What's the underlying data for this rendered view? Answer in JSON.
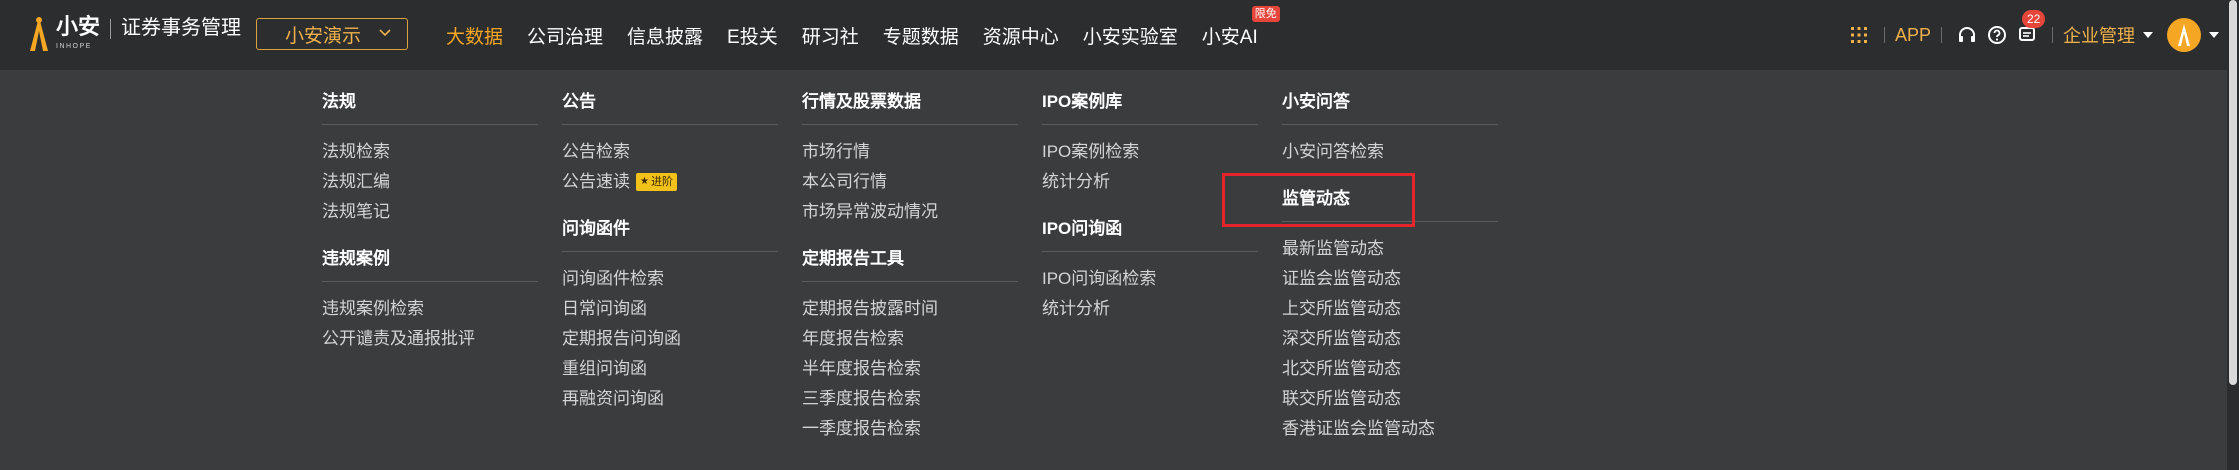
{
  "brand": {
    "name": "小安",
    "sub": "INHOPE",
    "product": "证券事务管理",
    "accent": "#f5a623"
  },
  "company_select": {
    "value": "小安演示"
  },
  "nav": [
    {
      "label": "大数据",
      "active": true
    },
    {
      "label": "公司治理"
    },
    {
      "label": "信息披露"
    },
    {
      "label": "E投关"
    },
    {
      "label": "研习社"
    },
    {
      "label": "专题数据"
    },
    {
      "label": "资源中心"
    },
    {
      "label": "小安实验室"
    },
    {
      "label": "小安AI",
      "badge": "限免"
    }
  ],
  "tools": {
    "grid_icon": "apps-grid-icon",
    "app_label": "APP",
    "headset_icon": "headset-icon",
    "help_icon": "question-icon",
    "message_icon": "message-icon",
    "notification_count": "22",
    "admin_label": "企业管理"
  },
  "menu": {
    "col1": {
      "g1": {
        "title": "法规",
        "items": [
          "法规检索",
          "法规汇编",
          "法规笔记"
        ]
      },
      "g2": {
        "title": "违规案例",
        "items": [
          "违规案例检索",
          "公开谴责及通报批评"
        ]
      }
    },
    "col2": {
      "g1": {
        "title": "公告",
        "items": [
          "公告检索",
          "公告速读"
        ],
        "tag": "进阶"
      },
      "g2": {
        "title": "问询函件",
        "items": [
          "问询函件检索",
          "日常问询函",
          "定期报告问询函",
          "重组问询函",
          "再融资问询函"
        ]
      }
    },
    "col3": {
      "g1": {
        "title": "行情及股票数据",
        "items": [
          "市场行情",
          "本公司行情",
          "市场异常波动情况"
        ]
      },
      "g2": {
        "title": "定期报告工具",
        "items": [
          "定期报告披露时间",
          "年度报告检索",
          "半年度报告检索",
          "三季度报告检索",
          "一季度报告检索"
        ]
      }
    },
    "col4": {
      "g1": {
        "title": "IPO案例库",
        "items": [
          "IPO案例检索",
          "统计分析"
        ]
      },
      "g2": {
        "title": "IPO问询函",
        "items": [
          "IPO问询函检索",
          "统计分析"
        ]
      }
    },
    "col5": {
      "g1": {
        "title": "小安问答",
        "items": [
          "小安问答检索"
        ]
      },
      "g2": {
        "title": "监管动态",
        "items": [
          "最新监管动态",
          "证监会监管动态",
          "上交所监管动态",
          "深交所监管动态",
          "北交所监管动态",
          "联交所监管动态",
          "香港证监会监管动态"
        ]
      }
    }
  }
}
